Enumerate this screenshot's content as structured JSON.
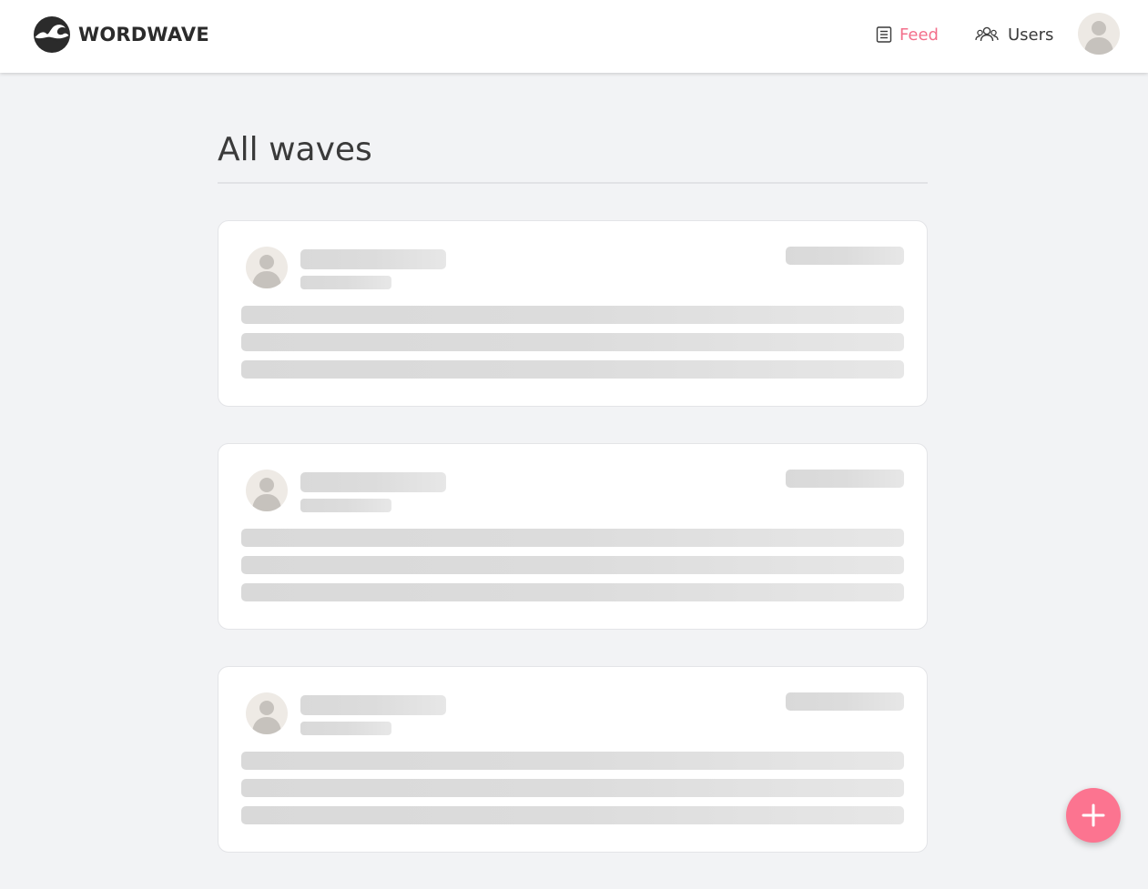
{
  "brand": {
    "name": "WORDWAVE",
    "logo_icon": "wave-logo-icon"
  },
  "nav": {
    "links": [
      {
        "label": "Feed",
        "icon": "feed-icon",
        "active": true
      },
      {
        "label": "Users",
        "icon": "users-icon",
        "active": false
      }
    ],
    "avatar_icon": "user-avatar-icon"
  },
  "page": {
    "title": "All waves"
  },
  "feed": {
    "cards": [
      {
        "state": "loading"
      },
      {
        "state": "loading"
      },
      {
        "state": "loading"
      }
    ]
  },
  "fab": {
    "icon": "plus-icon"
  },
  "colors": {
    "accent": "#fc7490",
    "active_link": "#f36f8b",
    "background": "#f2f3f5",
    "card": "#ffffff",
    "skeleton": "#d9d9d9"
  }
}
